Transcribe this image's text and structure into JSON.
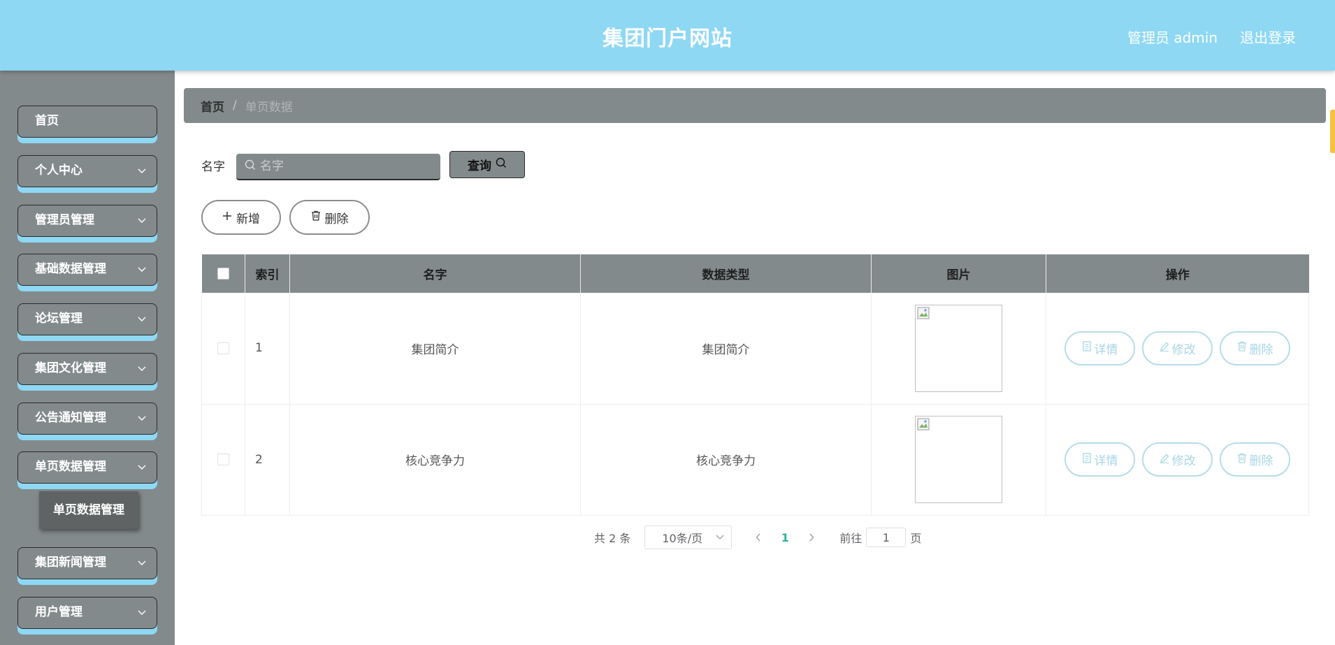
{
  "header": {
    "title": "集团门户网站",
    "user": "管理员 admin",
    "logout": "退出登录"
  },
  "sidebar": {
    "items": [
      {
        "label": "首页"
      },
      {
        "label": "个人中心"
      },
      {
        "label": "管理员管理"
      },
      {
        "label": "基础数据管理"
      },
      {
        "label": "论坛管理"
      },
      {
        "label": "集团文化管理"
      },
      {
        "label": "公告通知管理"
      },
      {
        "label": "单页数据管理"
      },
      {
        "label": "集团新闻管理"
      },
      {
        "label": "用户管理"
      }
    ],
    "submenu_active": "单页数据管理"
  },
  "breadcrumb": {
    "home": "首页",
    "separator": "/",
    "current": "单页数据"
  },
  "search": {
    "label": "名字",
    "placeholder": "名字",
    "query_button": "查询"
  },
  "actions": {
    "add": "新增",
    "delete": "删除"
  },
  "table": {
    "headers": {
      "index": "索引",
      "name": "名字",
      "type": "数据类型",
      "image": "图片",
      "ops": "操作"
    },
    "rows": [
      {
        "index": "1",
        "name": "集团简介",
        "type": "集团简介"
      },
      {
        "index": "2",
        "name": "核心竞争力",
        "type": "核心竞争力"
      }
    ],
    "ops": {
      "detail": "详情",
      "edit": "修改",
      "delete": "删除"
    }
  },
  "pagination": {
    "total": "共 2 条",
    "page_size": "10条/页",
    "current_page": "1",
    "goto_prefix": "前往",
    "goto_value": "1",
    "goto_suffix": "页"
  },
  "colors": {
    "header_bg": "#8ed8f4",
    "sidebar_bg": "#838a8c",
    "accent_shadow": "#8ed8f4",
    "op_button": "#a8d6e6",
    "active_page": "#2bb39a"
  }
}
